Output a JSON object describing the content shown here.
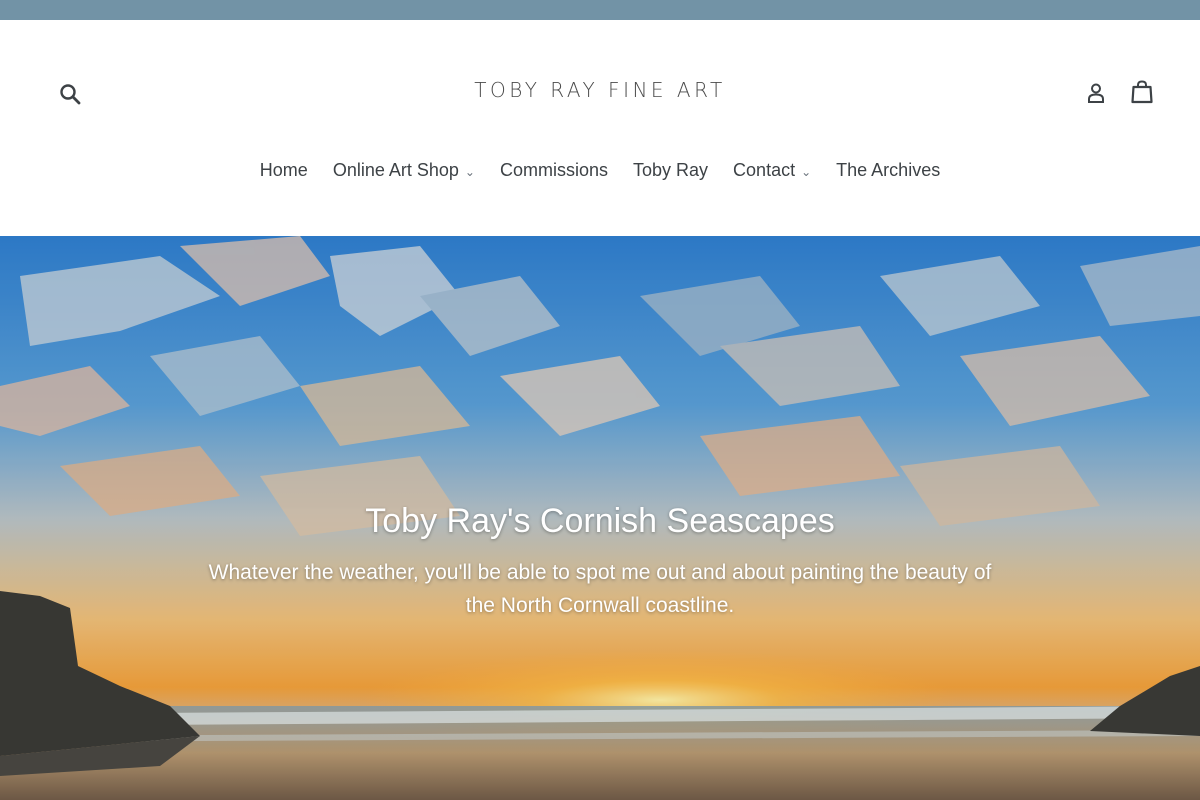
{
  "announcement_bar": {
    "color": "#7293a6"
  },
  "header": {
    "logo_text": "TOBY RAY FINE ART",
    "search_icon": "search-icon",
    "login_icon": "user-icon",
    "login_label": "Log in",
    "cart_icon": "cart-icon",
    "cart_label": "Cart"
  },
  "nav": {
    "items": [
      {
        "label": "Home",
        "has_dropdown": false
      },
      {
        "label": "Online Art Shop",
        "has_dropdown": true
      },
      {
        "label": "Commissions",
        "has_dropdown": false
      },
      {
        "label": "Toby Ray",
        "has_dropdown": false
      },
      {
        "label": "Contact",
        "has_dropdown": true
      },
      {
        "label": "The Archives",
        "has_dropdown": false
      }
    ]
  },
  "hero": {
    "title": "Toby Ray's Cornish Seascapes",
    "text": "Whatever the weather, you'll be able to spot me out and about painting the beauty of the North Cornwall coastline."
  },
  "colors": {
    "text": "#3d4246",
    "sky_blue": "#2f86d6",
    "sunset_orange": "#f0b04a"
  }
}
